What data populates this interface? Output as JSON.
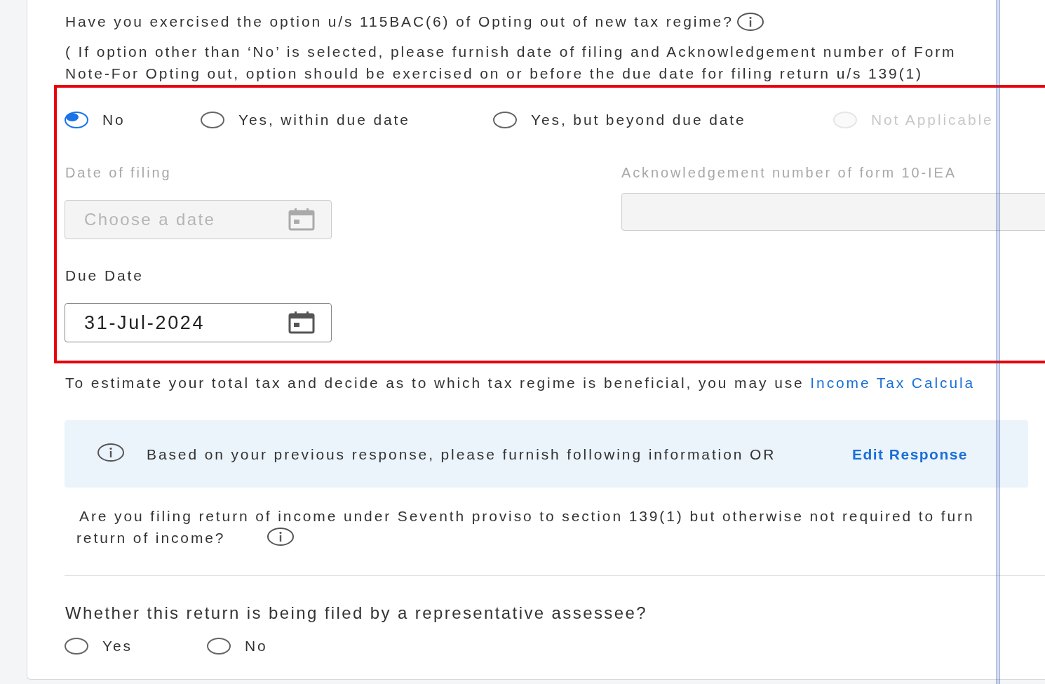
{
  "question": {
    "text": "Have you exercised the option u/s 115BAC(6) of Opting out of new tax regime?"
  },
  "note_lines": [
    "( If option other than ‘No’ is selected, please furnish date of filing and Acknowledgement  number of Form",
    "Note-For Opting out, option should be exercised on or before the due date for filing return u/s 139(1)"
  ],
  "options": [
    {
      "label": "No",
      "selected": true,
      "disabled": false
    },
    {
      "label": "Yes, within due date",
      "selected": false,
      "disabled": false
    },
    {
      "label": "Yes, but beyond due date",
      "selected": false,
      "disabled": false
    },
    {
      "label": "Not Applicable",
      "selected": false,
      "disabled": true
    }
  ],
  "date_of_filing": {
    "label": "Date of filing",
    "placeholder": "Choose a date",
    "disabled": true
  },
  "ack_number": {
    "label": "Acknowledgement number of form 10-IEA",
    "disabled": true
  },
  "due_date": {
    "label": "Due Date",
    "value": "31-Jul-2024",
    "disabled": false
  },
  "estimate": {
    "text": "To estimate your total tax and decide as to which tax regime is beneficial, you may use",
    "link": "Income Tax Calcula"
  },
  "info_banner": {
    "text": "Based on your previous response, please furnish following information OR",
    "link": "Edit Response"
  },
  "seventh_proviso": {
    "lines": [
      "Are you filing return of income under Seventh proviso to section 139(1) but otherwise not required to furn",
      "return of income?"
    ]
  },
  "representative": {
    "question": "Whether this return is being filed by a representative assessee?",
    "options": [
      {
        "label": "Yes",
        "selected": false
      },
      {
        "label": "No",
        "selected": false
      }
    ]
  }
}
